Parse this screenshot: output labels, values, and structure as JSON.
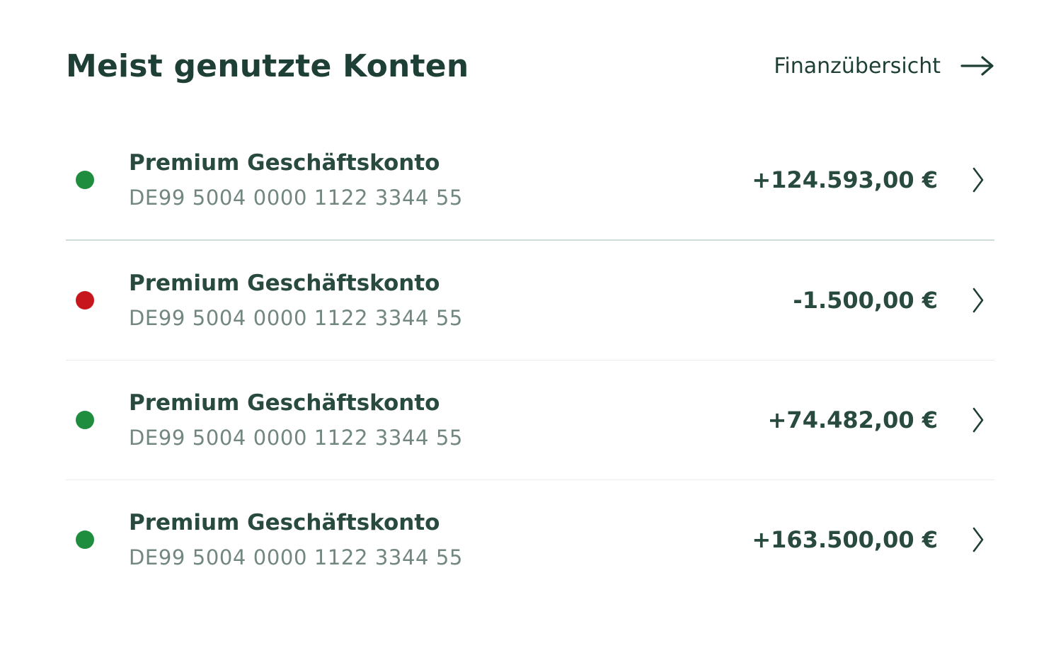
{
  "header": {
    "title": "Meist genutzte Konten",
    "overview_link": "Finanzübersicht",
    "overview_icon": "arrow-right-icon"
  },
  "accounts": [
    {
      "name": "Premium Geschäftskonto",
      "iban": "DE99 5004 0000 1122 3344 55",
      "amount": "+124.593,00 €",
      "status": "positive",
      "status_color": "#1e8e3e",
      "icon": "chevron-right-icon"
    },
    {
      "name": "Premium Geschäftskonto",
      "iban": "DE99 5004 0000 1122 3344 55",
      "amount": "-1.500,00 €",
      "status": "negative",
      "status_color": "#c8161d",
      "icon": "chevron-right-icon"
    },
    {
      "name": "Premium Geschäftskonto",
      "iban": "DE99 5004 0000 1122 3344 55",
      "amount": "+74.482,00 €",
      "status": "positive",
      "status_color": "#1e8e3e",
      "icon": "chevron-right-icon"
    },
    {
      "name": "Premium Geschäftskonto",
      "iban": "DE99 5004 0000 1122 3344 55",
      "amount": "+163.500,00 €",
      "status": "positive",
      "status_color": "#1e8e3e",
      "icon": "chevron-right-icon"
    }
  ],
  "colors": {
    "text_primary": "#1d3f35",
    "text_secondary": "#72877f",
    "positive": "#1e8e3e",
    "negative": "#c8161d",
    "divider": "#cfdcd6"
  }
}
